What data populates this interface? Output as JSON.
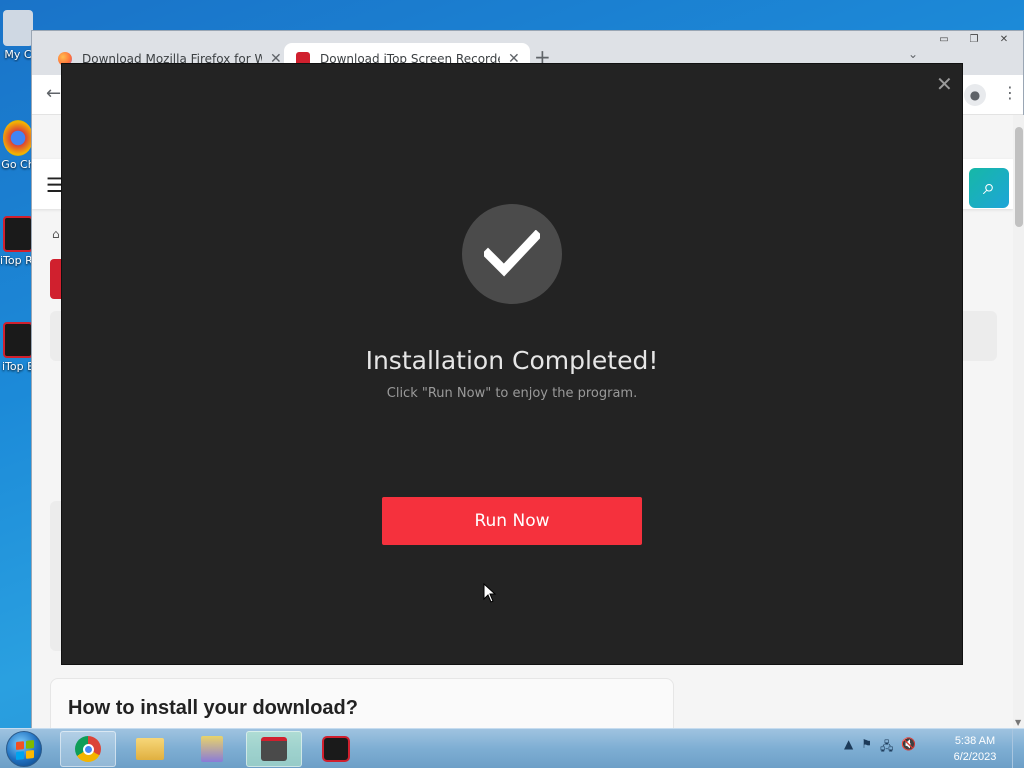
{
  "desktop": {
    "icons": [
      {
        "label": "My C",
        "color": "#4a78c8"
      },
      {
        "label": "Go Ch",
        "color": "#2ea44f"
      },
      {
        "label": "iTop Rec",
        "color": "#d0202e"
      },
      {
        "label": "iTop E",
        "color": "#d0202e"
      }
    ]
  },
  "browser": {
    "tabs": [
      {
        "title": "Download Mozilla Firefox for Wi",
        "close": "✕"
      },
      {
        "title": "Download iTop Screen Recorder",
        "close": "✕"
      }
    ],
    "new_tab": "+",
    "tab_list": "⌄",
    "window_controls": {
      "minimize": "▭",
      "restore": "❐",
      "close": "✕"
    },
    "toolbar": {
      "back": "←",
      "profile": "●",
      "menu": "⋮"
    }
  },
  "page": {
    "hamburger": "☰",
    "search_icon": "⌕",
    "home_icon": "⌂",
    "install_heading": "How to install your download?"
  },
  "modal": {
    "close": "✕",
    "title": "Installation Completed!",
    "subtitle": "Click \"Run Now\" to enjoy the program.",
    "run_button": "Run Now"
  },
  "taskbar": {
    "time": "5:38 AM",
    "date": "6/2/2023",
    "tray_icons": [
      "▲",
      "⚑",
      "🖧",
      "🔇"
    ]
  }
}
